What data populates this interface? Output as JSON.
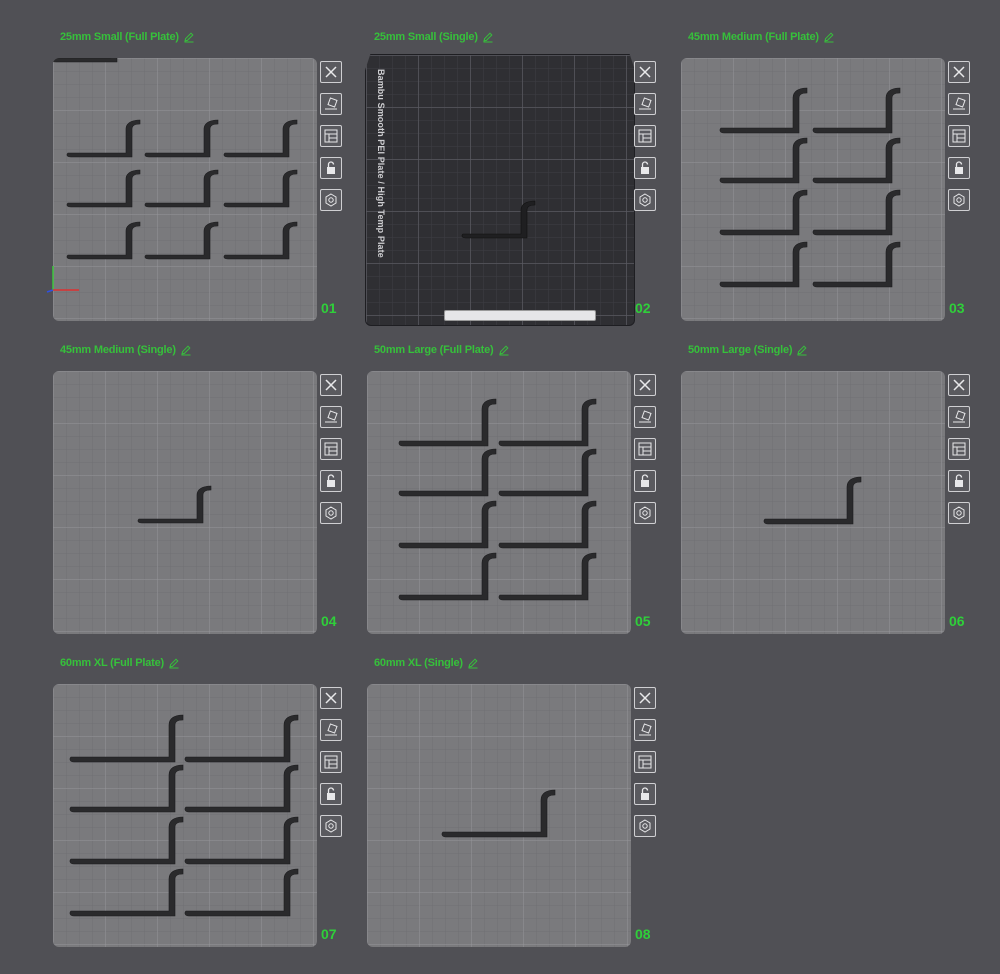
{
  "plates": [
    {
      "title": "25mm Small (Full Plate)",
      "number": "01",
      "layout": "grid3x3"
    },
    {
      "title": "25mm Small (Single)",
      "number": "02",
      "layout": "single",
      "plate_label": "Bambu Smooth PEI Plate / High Temp Plate"
    },
    {
      "title": "45mm Medium (Full Plate)",
      "number": "03",
      "layout": "grid2x4"
    },
    {
      "title": "45mm Medium (Single)",
      "number": "04",
      "layout": "single"
    },
    {
      "title": "50mm Large (Full Plate)",
      "number": "05",
      "layout": "grid2x4"
    },
    {
      "title": "50mm Large (Single)",
      "number": "06",
      "layout": "single"
    },
    {
      "title": "60mm XL (Full Plate)",
      "number": "07",
      "layout": "grid2x4"
    },
    {
      "title": "60mm XL (Single)",
      "number": "08",
      "layout": "single"
    }
  ],
  "tool_icons": [
    "close-icon",
    "auto-orient-icon",
    "arrange-icon",
    "lock-icon",
    "settings-icon"
  ],
  "colors": {
    "accent": "#36c03b",
    "plate": "#7a7a7d",
    "hook": "#2a2a2c",
    "background": "#505055"
  }
}
